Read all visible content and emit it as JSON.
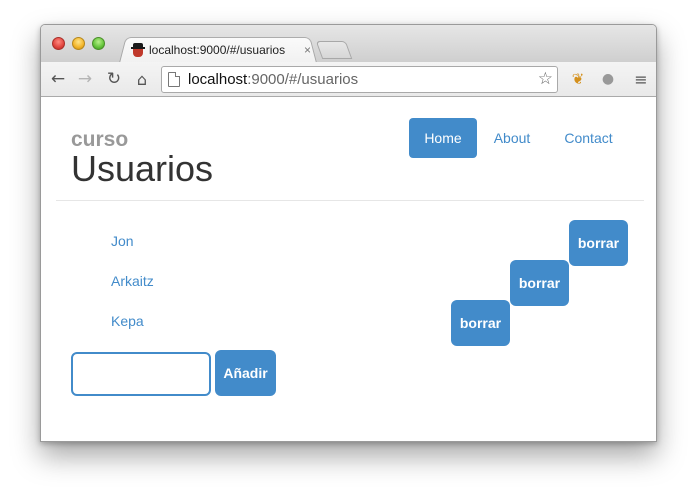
{
  "browser": {
    "tab_title": "localhost:9000/#/usuarios",
    "tab_close": "×",
    "url_host": "localhost",
    "url_rest": ":9000/#/usuarios",
    "icons": {
      "back": "back-arrow-icon",
      "forward": "forward-arrow-icon",
      "reload": "reload-icon",
      "home": "home-icon",
      "bookmark": "star-icon",
      "menu": "menu-icon"
    }
  },
  "brand": {
    "small": "curso",
    "big": "Usuarios"
  },
  "nav": {
    "items": [
      {
        "label": "Home",
        "active": true
      },
      {
        "label": "About",
        "active": false
      },
      {
        "label": "Contact",
        "active": false
      }
    ]
  },
  "users": [
    {
      "name": "Jon",
      "delete_label": "borrar"
    },
    {
      "name": "Arkaitz",
      "delete_label": "borrar"
    },
    {
      "name": "Kepa",
      "delete_label": "borrar"
    }
  ],
  "form": {
    "input_value": "",
    "add_label": "Añadir"
  },
  "colors": {
    "accent": "#428bca",
    "heading": "#333333",
    "muted": "#999999"
  }
}
